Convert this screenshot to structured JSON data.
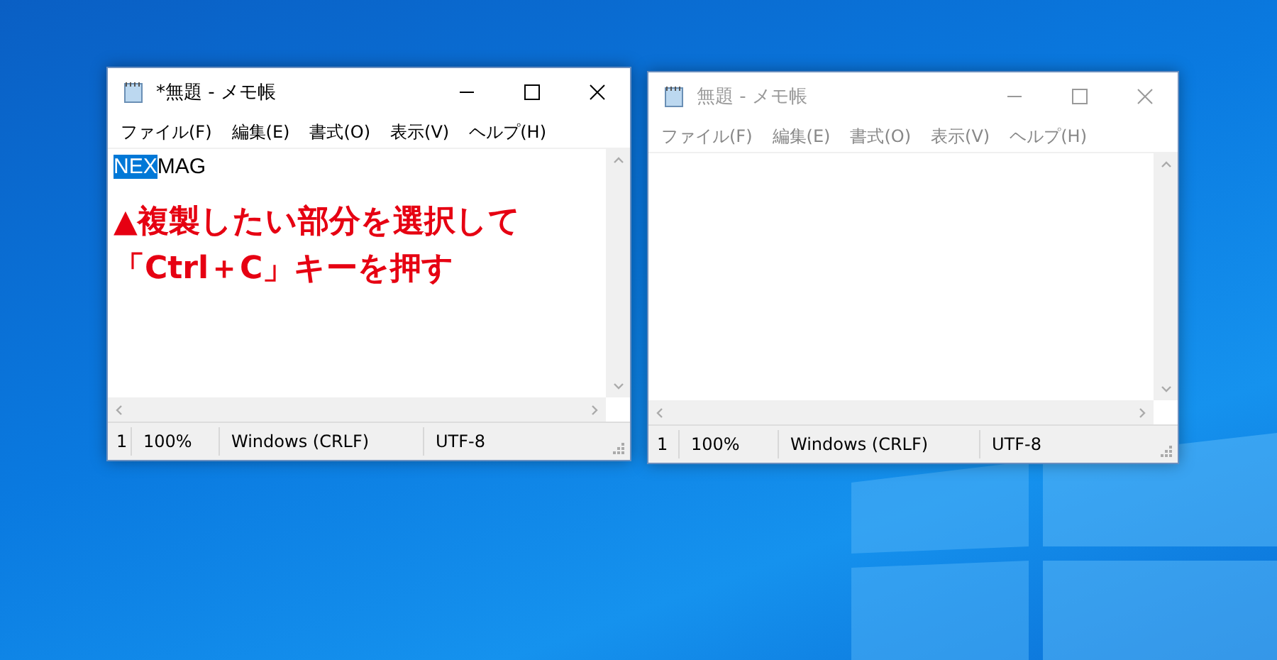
{
  "windows": [
    {
      "title": "*無題 - メモ帳",
      "active": true,
      "menu": [
        "ファイル(F)",
        "編集(E)",
        "書式(O)",
        "表示(V)",
        "ヘルプ(H)"
      ],
      "content": [
        {
          "text": "NEX",
          "selected": true
        },
        {
          "text": "MAG",
          "selected": false
        }
      ],
      "status": [
        "1",
        "100%",
        "Windows (CRLF)",
        "UTF-8"
      ]
    },
    {
      "title": "無題 - メモ帳",
      "active": false,
      "menu": [
        "ファイル(F)",
        "編集(E)",
        "書式(O)",
        "表示(V)",
        "ヘルプ(H)"
      ],
      "status": [
        "1",
        "100%",
        "Windows (CRLF)",
        "UTF-8"
      ]
    }
  ],
  "annotation": {
    "lines": [
      "▲複製したい部分を選択して",
      "「Ctrl＋C」キーを押す"
    ]
  }
}
